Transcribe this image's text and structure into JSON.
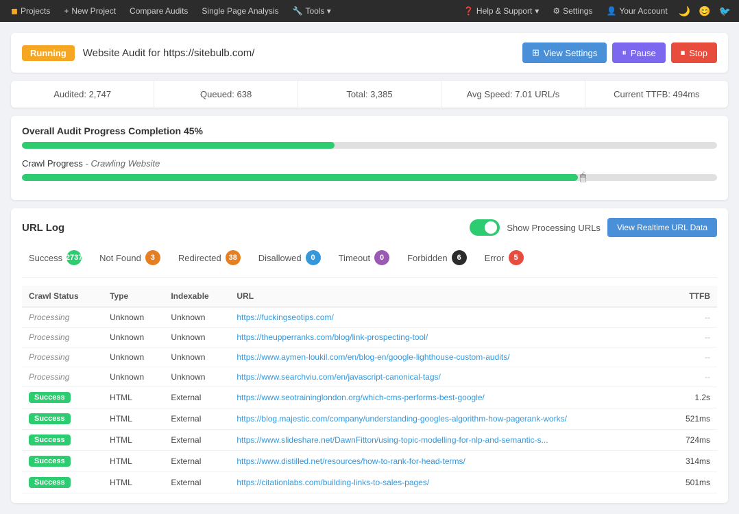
{
  "topnav": {
    "items": [
      {
        "id": "projects",
        "label": "Projects",
        "icon": "◼"
      },
      {
        "id": "new-project",
        "label": "New Project",
        "icon": "+"
      },
      {
        "id": "compare-audits",
        "label": "Compare Audits"
      },
      {
        "id": "single-page-analysis",
        "label": "Single Page Analysis"
      },
      {
        "id": "tools",
        "label": "Tools ▾",
        "icon": "🔧"
      }
    ],
    "right_items": [
      {
        "id": "help",
        "label": "Help & Support",
        "icon": "?",
        "has_dropdown": true
      },
      {
        "id": "settings",
        "label": "Settings",
        "icon": "⚙"
      },
      {
        "id": "account",
        "label": "Your Account",
        "icon": "👤"
      },
      {
        "id": "dark-mode",
        "icon": "🌙"
      },
      {
        "id": "emoji",
        "icon": "😊"
      },
      {
        "id": "twitter",
        "icon": "🐦"
      }
    ]
  },
  "audit": {
    "status_badge": "Running",
    "title": "Website Audit for https://sitebulb.com/",
    "buttons": {
      "view_settings": "View Settings",
      "pause": "Pause",
      "stop": "Stop"
    }
  },
  "stats": [
    {
      "label": "Audited: 2,747"
    },
    {
      "label": "Queued: 638"
    },
    {
      "label": "Total: 3,385"
    },
    {
      "label": "Avg Speed: 7.01 URL/s"
    },
    {
      "label": "Current TTFB: 494ms"
    }
  ],
  "overall_progress": {
    "label": "Overall Audit Progress Completion 45%",
    "percent": 45
  },
  "crawl_progress": {
    "label": "Crawl Progress",
    "sub": "Crawling Website",
    "percent": 80
  },
  "url_log": {
    "title": "URL Log",
    "show_processing_label": "Show Processing URLs",
    "realtime_btn": "View Realtime URL Data",
    "filters": [
      {
        "id": "success",
        "label": "Success",
        "count": "2737",
        "badge_class": "badge-green"
      },
      {
        "id": "not-found",
        "label": "Not Found",
        "count": "3",
        "badge_class": "badge-orange"
      },
      {
        "id": "redirected",
        "label": "Redirected",
        "count": "38",
        "badge_class": "badge-orange"
      },
      {
        "id": "disallowed",
        "label": "Disallowed",
        "count": "0",
        "badge_class": "badge-blue"
      },
      {
        "id": "timeout",
        "label": "Timeout",
        "count": "0",
        "badge_class": "badge-purple"
      },
      {
        "id": "forbidden",
        "label": "Forbidden",
        "count": "6",
        "badge_class": "badge-dark"
      },
      {
        "id": "error",
        "label": "Error",
        "count": "5",
        "badge_class": "badge-red"
      }
    ],
    "table_headers": [
      "Crawl Status",
      "Type",
      "Indexable",
      "URL",
      "TTFB"
    ],
    "rows": [
      {
        "status": "Processing",
        "type": "Unknown",
        "indexable": "Unknown",
        "url": "https://fuckingseotips.com/",
        "ttfb": "--",
        "is_processing": true
      },
      {
        "status": "Processing",
        "type": "Unknown",
        "indexable": "Unknown",
        "url": "https://theupperranks.com/blog/link-prospecting-tool/",
        "ttfb": "--",
        "is_processing": true
      },
      {
        "status": "Processing",
        "type": "Unknown",
        "indexable": "Unknown",
        "url": "https://www.aymen-loukil.com/en/blog-en/google-lighthouse-custom-audits/",
        "ttfb": "--",
        "is_processing": true
      },
      {
        "status": "Processing",
        "type": "Unknown",
        "indexable": "Unknown",
        "url": "https://www.searchviu.com/en/javascript-canonical-tags/",
        "ttfb": "--",
        "is_processing": true
      },
      {
        "status": "Success",
        "type": "HTML",
        "indexable": "External",
        "url": "https://www.seotraininglondon.org/which-cms-performs-best-google/",
        "ttfb": "1.2s",
        "is_processing": false
      },
      {
        "status": "Success",
        "type": "HTML",
        "indexable": "External",
        "url": "https://blog.majestic.com/company/understanding-googles-algorithm-how-pagerank-works/",
        "ttfb": "521ms",
        "is_processing": false
      },
      {
        "status": "Success",
        "type": "HTML",
        "indexable": "External",
        "url": "https://www.slideshare.net/DawnFitton/using-topic-modelling-for-nlp-and-semantic-s...",
        "ttfb": "724ms",
        "is_processing": false
      },
      {
        "status": "Success",
        "type": "HTML",
        "indexable": "External",
        "url": "https://www.distilled.net/resources/how-to-rank-for-head-terms/",
        "ttfb": "314ms",
        "is_processing": false
      },
      {
        "status": "Success",
        "type": "HTML",
        "indexable": "External",
        "url": "https://citationlabs.com/building-links-to-sales-pages/",
        "ttfb": "501ms",
        "is_processing": false
      }
    ]
  }
}
